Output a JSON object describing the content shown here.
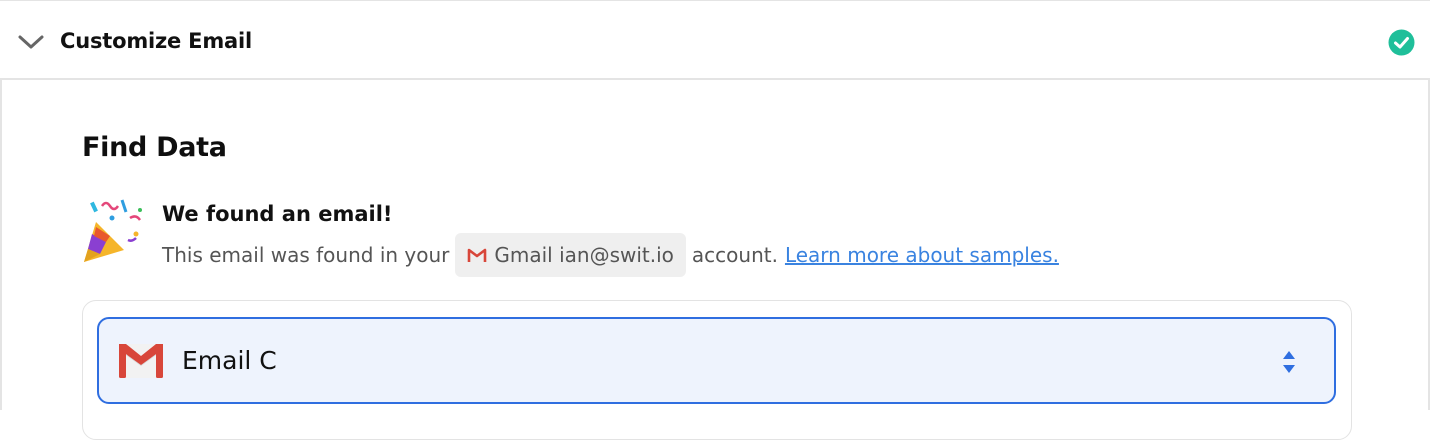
{
  "header": {
    "title": "Customize Email",
    "status": "complete",
    "accent_color": "#1fbf9a"
  },
  "section": {
    "title": "Find Data"
  },
  "found": {
    "title": "We found an email!",
    "desc_prefix": "This email was found in your",
    "account_chip": "Gmail ian@swit.io",
    "desc_suffix": "account.",
    "link_text": "Learn more about samples."
  },
  "sample_select": {
    "selected": "Email C",
    "icon": "gmail-icon",
    "border_color": "#2f6ee0"
  }
}
